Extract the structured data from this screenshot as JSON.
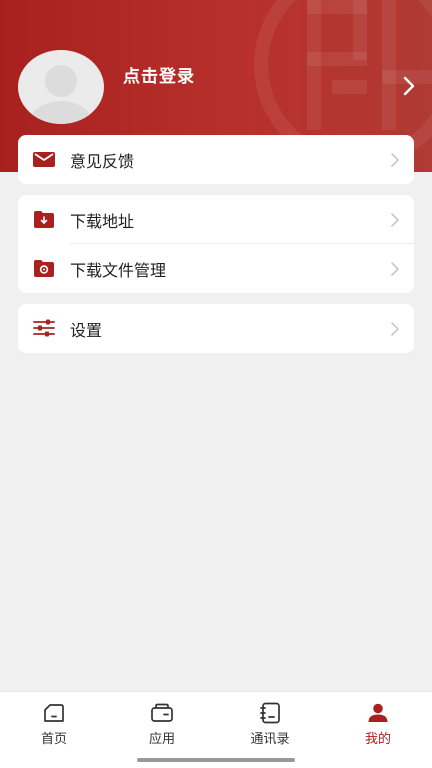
{
  "colors": {
    "brand": "#a9211f",
    "background": "#f0f0f0",
    "card": "#ffffff"
  },
  "profile": {
    "login_label": "点击登录"
  },
  "menu": {
    "group1": [
      {
        "label": "意见反馈",
        "icon": "mail-icon"
      }
    ],
    "group2": [
      {
        "label": "下载地址",
        "icon": "download-folder-icon"
      },
      {
        "label": "下载文件管理",
        "icon": "folder-manage-icon"
      }
    ],
    "group3": [
      {
        "label": "设置",
        "icon": "sliders-icon"
      }
    ]
  },
  "tabbar": {
    "items": [
      {
        "label": "首页",
        "icon": "home-icon"
      },
      {
        "label": "应用",
        "icon": "wallet-icon"
      },
      {
        "label": "通讯录",
        "icon": "contacts-icon"
      },
      {
        "label": "我的",
        "icon": "user-icon",
        "active": true
      }
    ]
  }
}
